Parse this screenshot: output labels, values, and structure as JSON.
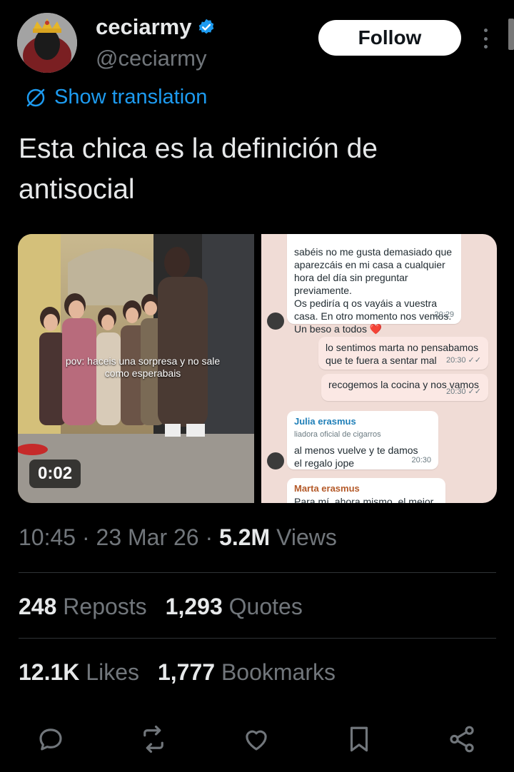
{
  "header": {
    "display_name": "ceciarmy",
    "handle": "@ceciarmy",
    "follow_label": "Follow"
  },
  "translation": {
    "label": "Show translation"
  },
  "tweet": {
    "text": "Esta chica es la definición de antisocial"
  },
  "media": {
    "video_caption": "pov: haceis una sorpresa y no sale como esperabais",
    "duration": "0:02",
    "chat": {
      "msg1_text": "sabéis no me gusta demasiado que aparezcáis en mi casa a cualquier hora del día sin preguntar previamente.\nOs pediría q os vayáis a vuestra casa. En otro momento nos vemos. Un beso a todos ❤️",
      "msg1_time": "20:29",
      "msg2_text": "lo sentimos marta no pensabamos que te fuera a sentar mal",
      "msg2_time": "20:30 ✓✓",
      "msg3_text": "recogemos la cocina y nos vamos",
      "msg3_time": "20:30 ✓✓",
      "msg4_sender": "Julia erasmus",
      "msg4_role": "liadora oficial de cigarros",
      "msg4_text": "al menos vuelve y te damos el regalo jope",
      "msg4_time": "20:30",
      "msg5_sender": "Marta erasmus",
      "msg5_text": "Para mí, ahora mismo, el mejor"
    }
  },
  "meta": {
    "time": "10:45",
    "date": "23 Mar 26",
    "views_count": "5.2M",
    "views_label": "Views"
  },
  "stats": {
    "reposts_count": "248",
    "reposts_label": "Reposts",
    "quotes_count": "1,293",
    "quotes_label": "Quotes",
    "likes_count": "12.1K",
    "likes_label": "Likes",
    "bookmarks_count": "1,777",
    "bookmarks_label": "Bookmarks"
  },
  "colors": {
    "accent": "#1d9bf0",
    "background": "#000000",
    "text_primary": "#e7e9ea",
    "text_secondary": "#71767b"
  },
  "icons": [
    "verified-badge-icon",
    "translate-icon",
    "more-icon",
    "reply-icon",
    "repost-icon",
    "like-icon",
    "bookmark-icon",
    "share-icon"
  ]
}
